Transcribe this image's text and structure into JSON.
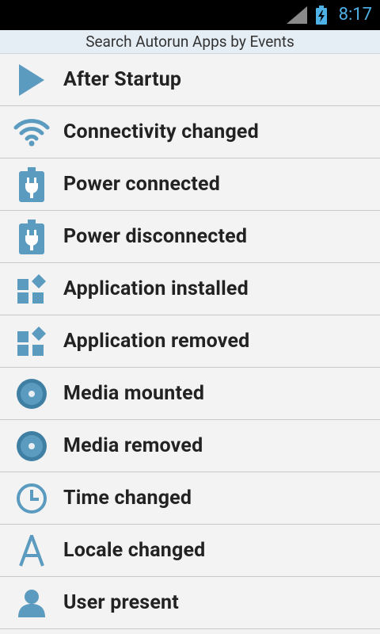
{
  "status_bar": {
    "time": "8:17"
  },
  "header": {
    "title": "Search Autorun Apps by Events"
  },
  "events": [
    {
      "label": "After Startup",
      "icon": "play-icon"
    },
    {
      "label": "Connectivity changed",
      "icon": "wifi-icon"
    },
    {
      "label": "Power connected",
      "icon": "battery-plug-icon"
    },
    {
      "label": "Power disconnected",
      "icon": "battery-plug-icon"
    },
    {
      "label": "Application installed",
      "icon": "apps-grid-icon"
    },
    {
      "label": "Application removed",
      "icon": "apps-grid-icon"
    },
    {
      "label": "Media mounted",
      "icon": "disc-icon"
    },
    {
      "label": "Media removed",
      "icon": "disc-icon"
    },
    {
      "label": "Time changed",
      "icon": "clock-icon"
    },
    {
      "label": "Locale changed",
      "icon": "locale-a-icon"
    },
    {
      "label": "User present",
      "icon": "user-icon"
    }
  ],
  "colors": {
    "icon": "#5b9bbf",
    "icon_dark": "#3f7fa3",
    "status_text": "#4fb2e6"
  }
}
